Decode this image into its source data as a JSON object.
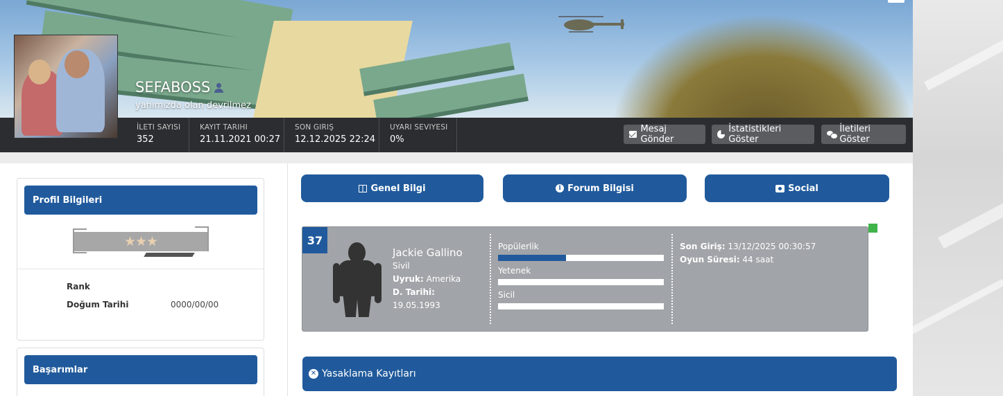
{
  "profile": {
    "username": "SEFABOSS",
    "tagline": "yanımızda olan devrilmez"
  },
  "stats": [
    {
      "label": "İLETI SAYISI",
      "value": "352"
    },
    {
      "label": "KAYIT TARIHI",
      "value": "21.11.2021 00:27"
    },
    {
      "label": "SON GIRIŞ",
      "value": "12.12.2025 22:24"
    },
    {
      "label": "UYARI SEVIYESI",
      "value": "0%"
    }
  ],
  "header_buttons": {
    "message": "Mesaj Gönder",
    "statistics": "İstatistikleri Göster",
    "posts": "İletileri Göster"
  },
  "profile_card": {
    "title": "Profil Bilgileri",
    "stars": "★★★",
    "rank_label": "Rank",
    "rank_value": "",
    "birth_label": "Doğum Tarihi",
    "birth_value": "0000/00/00"
  },
  "achievements_card": {
    "title": "Başarımlar"
  },
  "tabs": [
    {
      "label": "Genel Bilgi"
    },
    {
      "label": "Forum Bilgisi"
    },
    {
      "label": "Social"
    }
  ],
  "character": {
    "level": "37",
    "name": "Jackie Gallino",
    "faction": "Sivil",
    "nationality_label": "Uyruk:",
    "nationality": "Amerika",
    "birth_label": "D. Tarihi:",
    "birth": "19.05.1993",
    "bars": [
      {
        "label": "Popülerlik",
        "value": 0.41
      },
      {
        "label": "Yetenek",
        "value": 0
      },
      {
        "label": "Sicil",
        "value": 0
      }
    ],
    "last_login_label": "Son Giriş:",
    "last_login": "13/12/2025 00:30:57",
    "playtime_label": "Oyun Süresi:",
    "playtime": "44 saat"
  },
  "ban_records": {
    "title": "Yasaklama Kayıtları"
  },
  "colors": {
    "accent": "#205a9c",
    "statsbar": "#2b2d30",
    "card_grey": "#a1a4a8",
    "online": "#3fb44a"
  }
}
